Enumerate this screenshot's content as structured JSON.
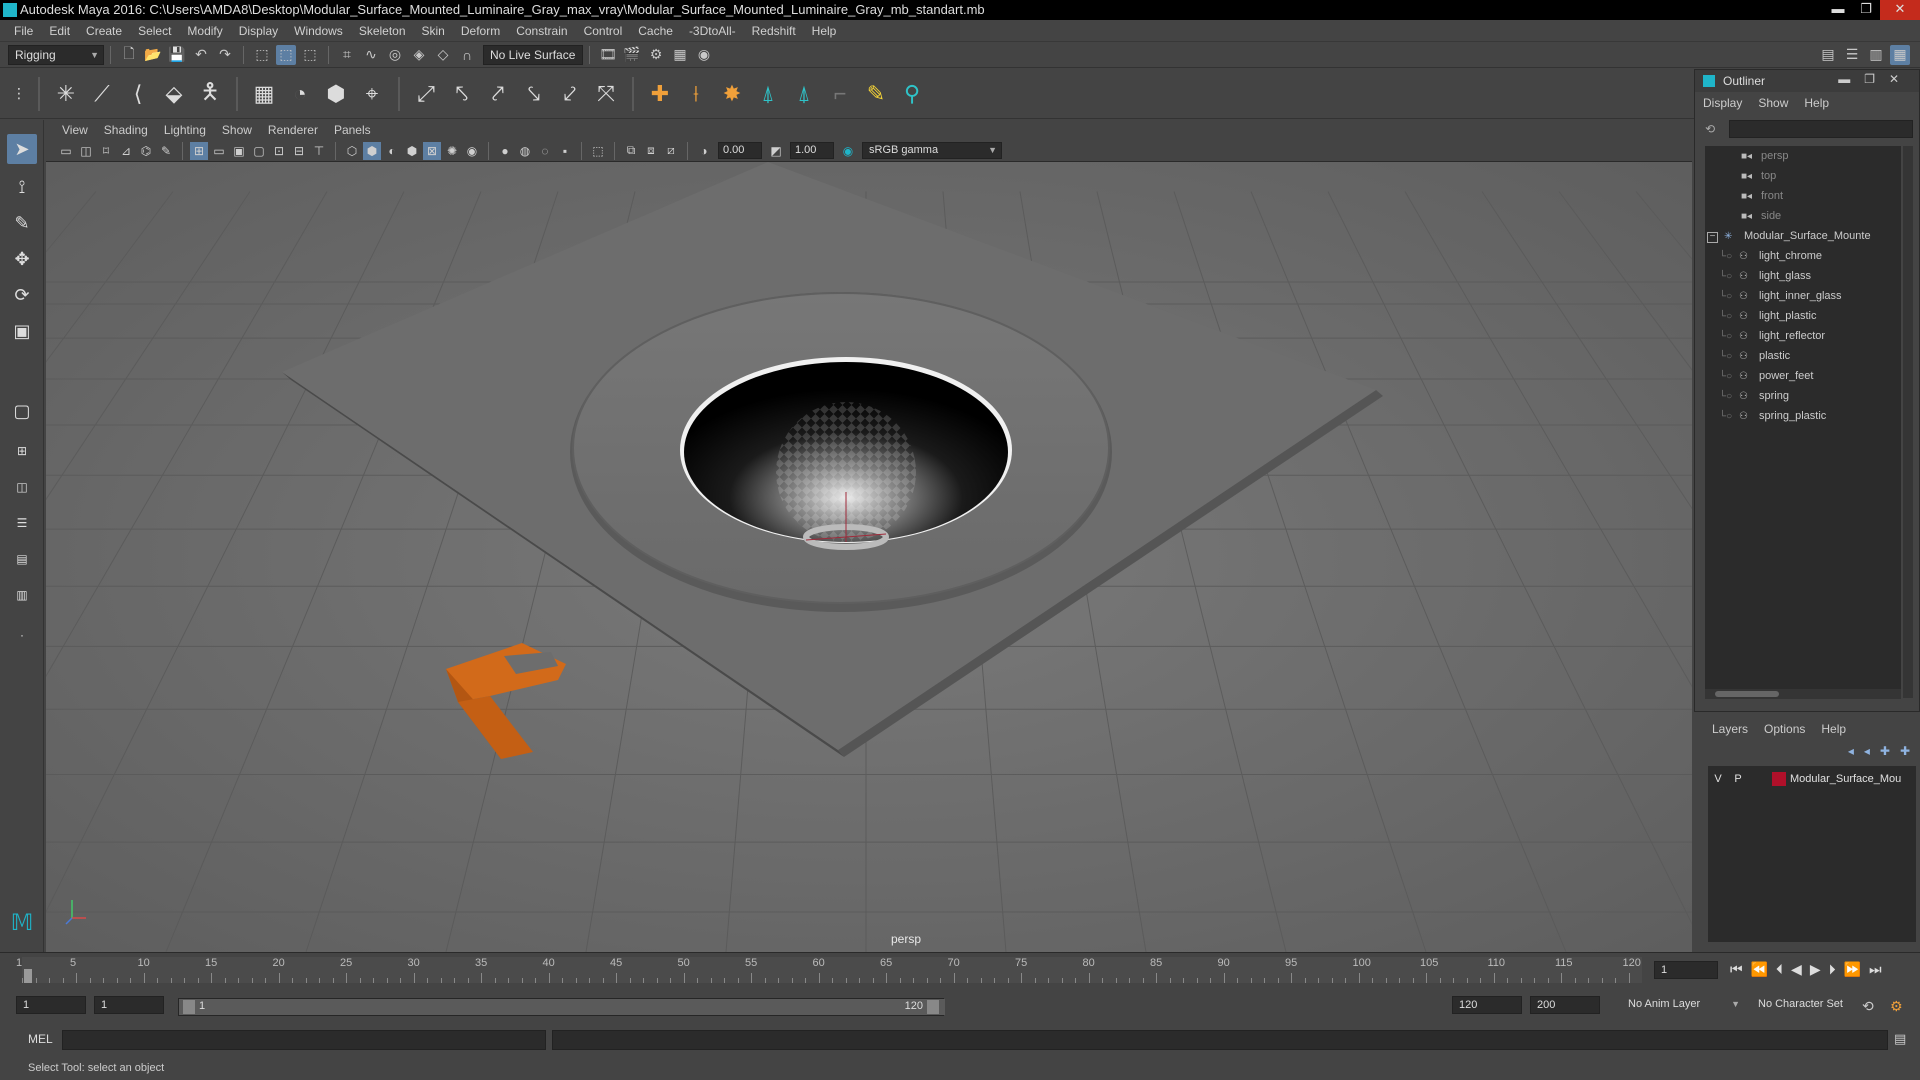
{
  "window": {
    "title": "Autodesk Maya 2016: C:\\Users\\AMDA8\\Desktop\\Modular_Surface_Mounted_Luminaire_Gray_max_vray\\Modular_Surface_Mounted_Luminaire_Gray_mb_standart.mb",
    "minimize": "▬",
    "maximize": "❐",
    "close": "✕"
  },
  "menubar": [
    "File",
    "Edit",
    "Create",
    "Select",
    "Modify",
    "Display",
    "Windows",
    "Skeleton",
    "Skin",
    "Deform",
    "Constrain",
    "Control",
    "Cache",
    "-3DtoAll-",
    "Redshift",
    "Help"
  ],
  "statusline": {
    "mode": "Rigging",
    "live_surface": "No Live Surface"
  },
  "viewport": {
    "menu": [
      "View",
      "Shading",
      "Lighting",
      "Show",
      "Renderer",
      "Panels"
    ],
    "exposure": "0.00",
    "gamma": "1.00",
    "color_space": "sRGB gamma",
    "camera_label": "persp"
  },
  "outliner": {
    "title": "Outliner",
    "menu": [
      "Display",
      "Show",
      "Help"
    ],
    "cameras": [
      "persp",
      "top",
      "front",
      "side"
    ],
    "root": "Modular_Surface_Mounte",
    "children": [
      "light_chrome",
      "light_glass",
      "light_inner_glass",
      "light_plastic",
      "light_reflector",
      "plastic",
      "power_feet",
      "spring",
      "spring_plastic"
    ]
  },
  "layers": {
    "menu": [
      "Layers",
      "Options",
      "Help"
    ],
    "row": {
      "v": "V",
      "p": "P",
      "name": "Modular_Surface_Mou",
      "color": "#b0102a"
    }
  },
  "timeslider": {
    "ticks": [
      1,
      5,
      10,
      15,
      20,
      25,
      30,
      35,
      40,
      45,
      50,
      55,
      60,
      65,
      70,
      75,
      80,
      85,
      90,
      95,
      100,
      105,
      110,
      115,
      120
    ],
    "current_frame": "1"
  },
  "range": {
    "start": "1",
    "playback_start": "1",
    "range_start_label": "1",
    "range_end_label": "120",
    "playback_end": "120",
    "end": "200",
    "anim_layer": "No Anim Layer",
    "character_set": "No Character Set"
  },
  "cmdline": {
    "label": "MEL"
  },
  "helpline": "Select Tool: select an object",
  "colors": {
    "accent": "#5d7fa3",
    "bracket": "#d26a1a",
    "layer": "#b0102a"
  }
}
